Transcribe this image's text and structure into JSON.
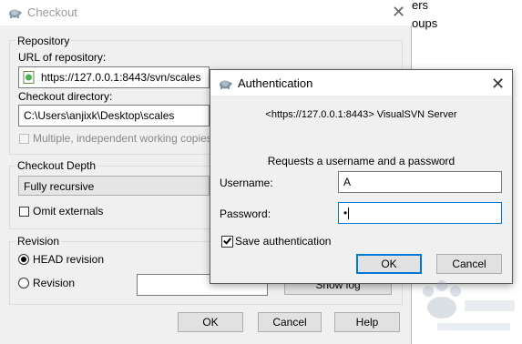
{
  "background": {
    "text_line1": "ers",
    "text_line2": "oups"
  },
  "checkout": {
    "title": "Checkout",
    "repository_group": "Repository",
    "url_label": "URL of repository:",
    "url_value": "https://127.0.0.1:8443/svn/scales",
    "dir_label": "Checkout directory:",
    "dir_value": "C:\\Users\\anjixk\\Desktop\\scales",
    "multiple_label": "Multiple, independent working copies",
    "depth_group": "Checkout Depth",
    "depth_value": "Fully recursive",
    "omit_label": "Omit externals",
    "revision_group": "Revision",
    "head_label": "HEAD revision",
    "revision_label": "Revision",
    "show_log_label": "Show log",
    "ok_label": "OK",
    "cancel_label": "Cancel",
    "help_label": "Help"
  },
  "auth": {
    "title": "Authentication",
    "server": "<https://127.0.0.1:8443> VisualSVN Server",
    "prompt": "Requests a username and a password",
    "username_label": "Username:",
    "username_value": "A",
    "password_label": "Password:",
    "password_mask": "•",
    "save_label": "Save authentication",
    "save_checked": true,
    "ok_label": "OK",
    "cancel_label": "Cancel"
  }
}
